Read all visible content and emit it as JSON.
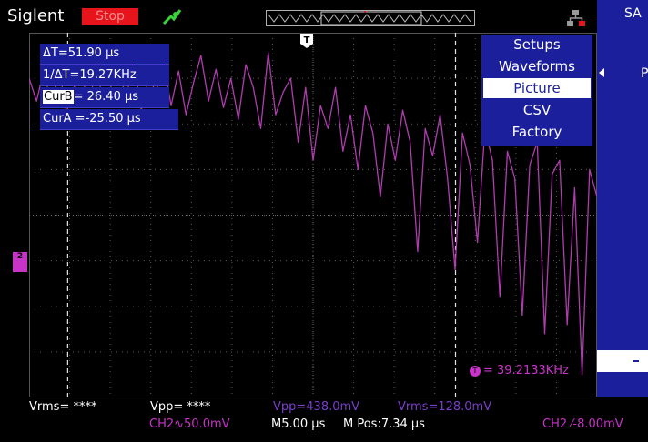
{
  "header": {
    "brand": "Siglent",
    "run_state": "Stop",
    "menu_tab": "SA"
  },
  "colors": {
    "panel_blue": "#1b1f9c",
    "channel2": "#c833c8",
    "stop_red": "#e8141c",
    "trigger_green": "#3ad33a"
  },
  "icons": {
    "trigger_state": "trigger-arrow-icon",
    "network": "network-icon",
    "channel_marker": "ch2-level-marker",
    "trigger_marker": "trigger-position-marker"
  },
  "cursors": {
    "delta_t": "ΔT=51.90 µs",
    "inv_delta_t": "1/ΔT=19.27KHz",
    "cur_b_tag": "CurB",
    "cur_b_value": "= 26.40 µs",
    "cur_a": "CurA =-25.50 µs",
    "cursor_times_us": [
      -25.5,
      26.4
    ]
  },
  "save_menu": {
    "items": [
      {
        "label": "Setups"
      },
      {
        "label": "Waveforms"
      },
      {
        "label": "Picture",
        "selected": true
      },
      {
        "label": "CSV"
      },
      {
        "label": "Factory"
      }
    ]
  },
  "side_panel": {
    "label": "P"
  },
  "channel_marker_label": "2",
  "trigger_marker_label": "T",
  "frequency_counter": {
    "icon_label": "T",
    "value": "= 39.2133KHz"
  },
  "measurements": {
    "vrms_unset": "Vrms= ****",
    "vpp_unset": "Vpp= ****",
    "vpp": "Vpp=438.0mV",
    "vrms": "Vrms=128.0mV"
  },
  "status": {
    "ch2_scale": "CH2∿50.0mV",
    "timebase": "M5.00 µs",
    "mpos": "M Pos:7.34 µs",
    "trigger_level": "CH2 ⁄-8.00mV"
  },
  "chart_data": {
    "type": "line",
    "x_unit": "us",
    "y_unit": "mV",
    "xlim": [
      -30.66,
      45.34
    ],
    "ylim": [
      -200,
      200
    ],
    "grid": true,
    "series": [
      {
        "x": [
          -30.66,
          -29.66,
          -28.66,
          -27.66,
          -26.66,
          -25.66,
          -24.66,
          -23.66,
          -22.66,
          -21.66,
          -20.66,
          -19.66,
          -18.66,
          -17.66,
          -16.66,
          -15.66,
          -14.66,
          -13.66,
          -12.66,
          -11.66,
          -10.66,
          -9.66,
          -8.66,
          -7.66,
          -6.66,
          -5.66,
          -4.66,
          -3.66,
          -2.66,
          -1.66,
          -0.66,
          0.34,
          1.34,
          2.34,
          3.34,
          4.34,
          5.34,
          6.34,
          7.34,
          8.34,
          9.34,
          10.34,
          11.34,
          12.34,
          13.34,
          14.34,
          15.34,
          16.34,
          17.34,
          18.34,
          19.34,
          20.34,
          21.34,
          22.34,
          23.34,
          24.34,
          25.34,
          26.34,
          27.34,
          28.34,
          29.34,
          30.34,
          31.34,
          32.34,
          33.34,
          34.34,
          35.34,
          36.34,
          37.34,
          38.34,
          39.34,
          40.34,
          41.34,
          42.34,
          43.34,
          44.34,
          45.34
        ],
        "y": [
          150,
          125,
          160,
          118,
          162,
          112,
          140,
          155,
          120,
          165,
          118,
          142,
          160,
          128,
          170,
          115,
          150,
          135,
          168,
          120,
          158,
          110,
          145,
          175,
          125,
          160,
          118,
          150,
          105,
          165,
          140,
          95,
          178,
          110,
          135,
          150,
          80,
          140,
          60,
          120,
          95,
          140,
          70,
          110,
          50,
          120,
          90,
          20,
          100,
          60,
          115,
          80,
          -40,
          95,
          65,
          110,
          40,
          -60,
          90,
          55,
          -30,
          95,
          60,
          -90,
          70,
          40,
          -110,
          55,
          80,
          -130,
          45,
          60,
          -120,
          30,
          -175,
          50,
          20
        ]
      }
    ]
  }
}
